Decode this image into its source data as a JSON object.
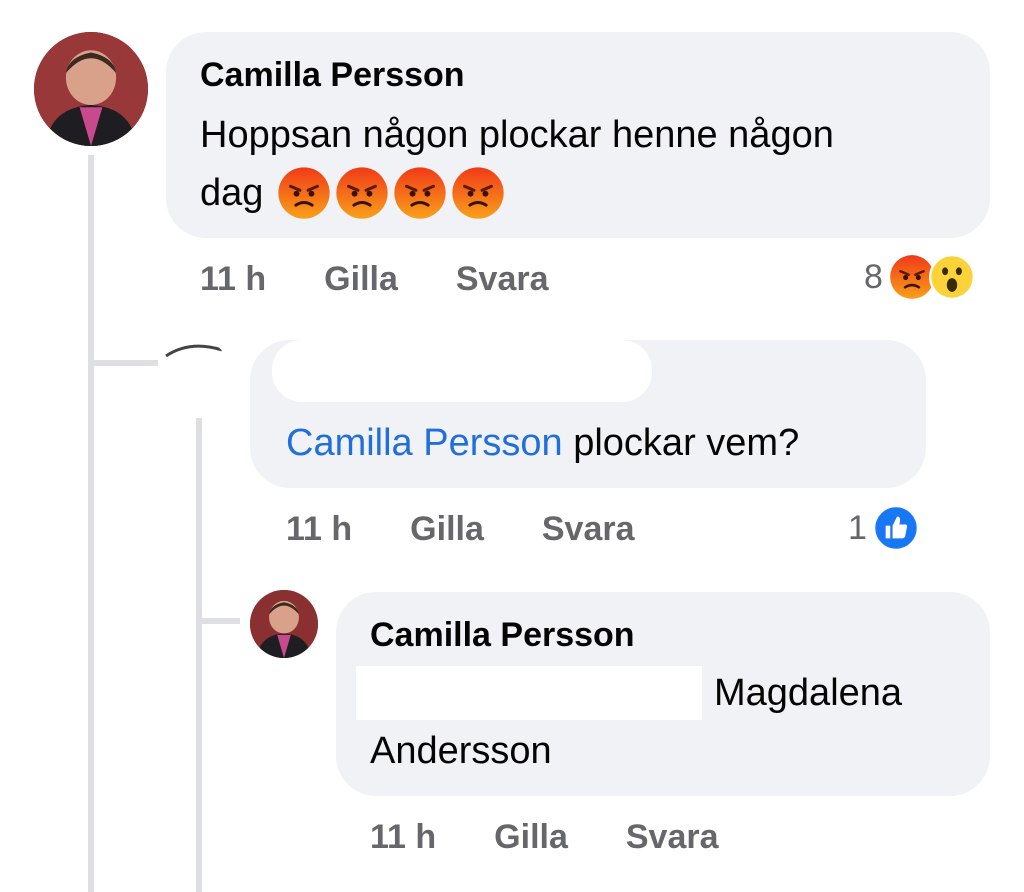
{
  "comment1": {
    "author": "Camilla Persson",
    "text_line1": "Hoppsan någon plockar henne någon",
    "text_line2": "dag",
    "emoji_count": 4,
    "emoji_icon": "angry-face-icon",
    "time": "11 h",
    "like_label": "Gilla",
    "reply_label": "Svara",
    "reaction_count": "8",
    "reaction_icons": [
      "angry-face-icon",
      "surprised-face-icon"
    ]
  },
  "comment2": {
    "mention": "Camilla Persson",
    "text": "plockar vem?",
    "time": "11 h",
    "like_label": "Gilla",
    "reply_label": "Svara",
    "reaction_count": "1",
    "reaction_icons": [
      "like-icon"
    ]
  },
  "comment3": {
    "author": "Camilla Persson",
    "text_line1": "Magdalena",
    "text_line2": "Andersson",
    "time": "11 h",
    "like_label": "Gilla",
    "reply_label": "Svara"
  },
  "colors": {
    "bubble": "#f0f2f5",
    "mention": "#216fdb",
    "meta": "#65676b",
    "like_blue": "#1877f2",
    "angry": "#f15a24"
  }
}
